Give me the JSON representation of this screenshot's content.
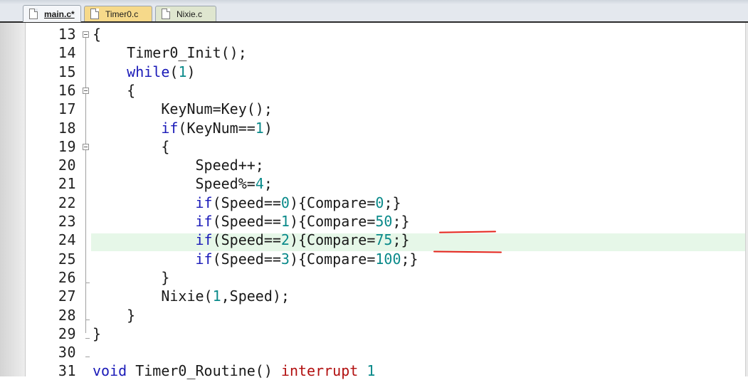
{
  "tabs": [
    {
      "label": "main.c*"
    },
    {
      "label": "Timer0.c"
    },
    {
      "label": "Nixie.c"
    }
  ],
  "editor": {
    "lines": [
      {
        "n": "13",
        "code": "{"
      },
      {
        "n": "14",
        "code": "    Timer0_Init();"
      },
      {
        "n": "15",
        "code": "    while(1)"
      },
      {
        "n": "16",
        "code": "    {"
      },
      {
        "n": "17",
        "code": "        KeyNum=Key();"
      },
      {
        "n": "18",
        "code": "        if(KeyNum==1)"
      },
      {
        "n": "19",
        "code": "        {"
      },
      {
        "n": "20",
        "code": "            Speed++;"
      },
      {
        "n": "21",
        "code": "            Speed%=4;"
      },
      {
        "n": "22",
        "code": "            if(Speed==0){Compare=0;}"
      },
      {
        "n": "23",
        "code": "            if(Speed==1){Compare=50;}"
      },
      {
        "n": "24",
        "code": "            if(Speed==2){Compare=75;}"
      },
      {
        "n": "25",
        "code": "            if(Speed==3){Compare=100;}"
      },
      {
        "n": "26",
        "code": "        }"
      },
      {
        "n": "27",
        "code": "        Nixie(1,Speed);"
      },
      {
        "n": "28",
        "code": "    }"
      },
      {
        "n": "29",
        "code": "}"
      },
      {
        "n": "30",
        "code": ""
      },
      {
        "n": "31",
        "code": "void Timer0_Routine() interrupt 1"
      }
    ],
    "highlighted_line": "24"
  },
  "colors": {
    "keyword": "#1a1ab8",
    "number": "#0a8a8a",
    "interrupt_keyword": "#b21010",
    "current_line": "#e6f7e8",
    "annotation": "#e4231b"
  }
}
